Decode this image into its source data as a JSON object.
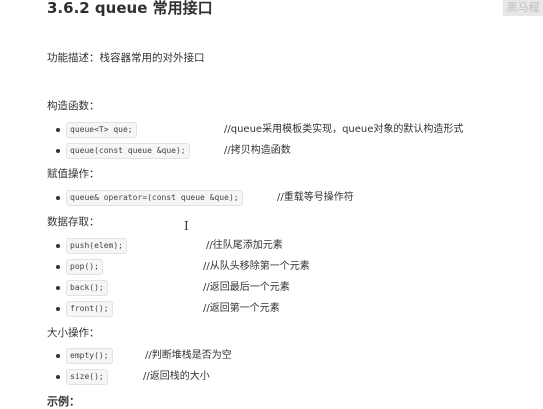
{
  "heading": "3.6.2 queue 常用接口",
  "watermark": "黑马程",
  "description": "功能描述：栈容器常用的对外接口",
  "sections": {
    "constructors": {
      "title": "构造函数：",
      "items": [
        {
          "code": "queue<T> que;",
          "comment": "//queue采用模板类实现，queue对象的默认构造形式"
        },
        {
          "code": "queue(const queue &que);",
          "comment": "//拷贝构造函数"
        }
      ]
    },
    "assignment": {
      "title": "赋值操作：",
      "items": [
        {
          "code": "queue& operator=(const queue &que);",
          "comment": "//重载等号操作符"
        }
      ]
    },
    "access": {
      "title": "数据存取：",
      "items": [
        {
          "code": "push(elem);",
          "comment": "//往队尾添加元素"
        },
        {
          "code": "pop();",
          "comment": "//从队头移除第一个元素"
        },
        {
          "code": "back();",
          "comment": "//返回最后一个元素"
        },
        {
          "code": "front();",
          "comment": "//返回第一个元素"
        }
      ]
    },
    "size": {
      "title": "大小操作：",
      "items": [
        {
          "code": "empty();",
          "comment": "//判断堆栈是否为空"
        },
        {
          "code": "size();",
          "comment": "//返回栈的大小"
        }
      ]
    }
  },
  "cursor": "I",
  "bottom_text": "示例："
}
